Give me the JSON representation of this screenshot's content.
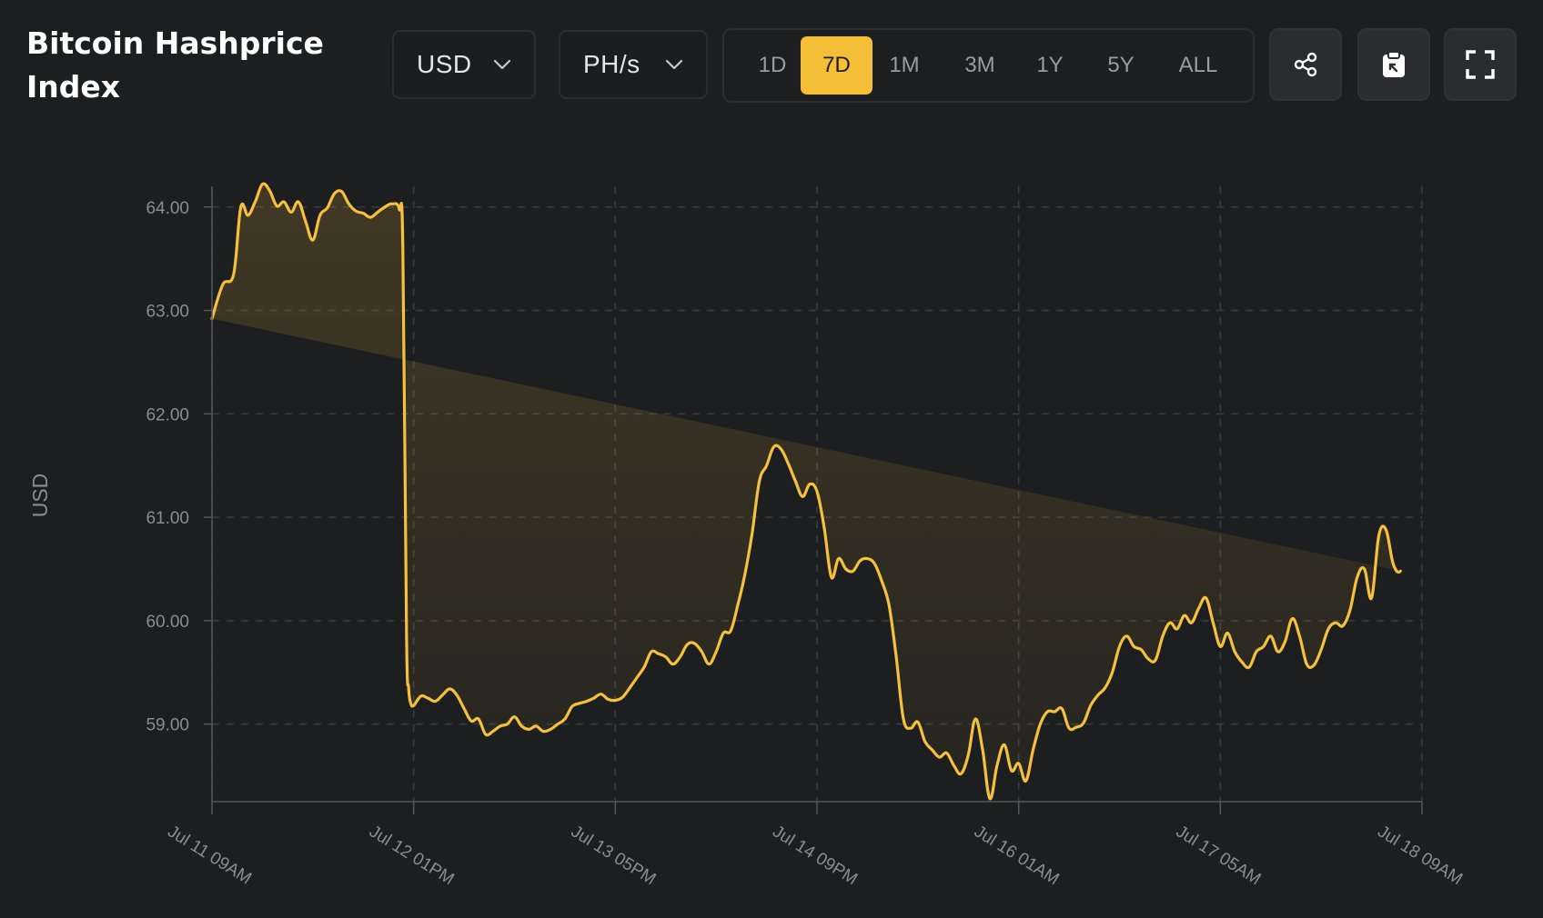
{
  "header": {
    "title": "Bitcoin Hashprice Index",
    "currency_dropdown": {
      "selected": "USD"
    },
    "unit_dropdown": {
      "selected": "PH/s"
    },
    "ranges": [
      {
        "label": "1D",
        "active": false
      },
      {
        "label": "7D",
        "active": true
      },
      {
        "label": "1M",
        "active": false
      },
      {
        "label": "3M",
        "active": false
      },
      {
        "label": "1Y",
        "active": false
      },
      {
        "label": "5Y",
        "active": false
      },
      {
        "label": "ALL",
        "active": false
      }
    ],
    "actions": [
      {
        "icon": "share-icon"
      },
      {
        "icon": "clipboard-icon"
      },
      {
        "icon": "fullscreen-icon"
      }
    ]
  },
  "colors": {
    "background": "#1d1e20",
    "accent": "#f4be37",
    "line": "#f5c13c",
    "grid": "#3a3c40",
    "tick_text": "#8a8c90"
  },
  "chart_data": {
    "type": "area",
    "ylabel": "USD",
    "ylim": [
      58.25,
      64.2
    ],
    "y_ticks": [
      "64.00",
      "63.00",
      "62.00",
      "61.00",
      "60.00",
      "59.00"
    ],
    "y_tick_values": [
      64,
      63,
      62,
      61,
      60,
      59
    ],
    "x_ticks": [
      "Jul 11 09AM",
      "Jul 12 01PM",
      "Jul 13 05PM",
      "Jul 14 09PM",
      "Jul 16 01AM",
      "Jul 17 05AM",
      "Jul 18 09AM"
    ],
    "x_range_hours": [
      0,
      168
    ],
    "x_tick_hours": [
      0,
      28,
      56,
      84,
      112,
      140,
      168
    ],
    "grid": true,
    "legend": "none",
    "series": [
      {
        "x_hours": [
          0,
          1.5,
          3,
          4,
          5,
          6,
          7,
          8,
          9,
          10,
          11,
          12,
          13,
          14,
          15,
          16,
          17,
          18,
          19,
          20,
          21,
          22,
          23,
          24,
          25,
          26,
          26.5,
          27,
          27.3,
          27.6,
          28,
          29,
          30,
          31,
          32,
          33,
          34,
          35,
          36,
          37,
          38,
          39,
          40,
          41,
          42,
          43,
          44,
          45,
          46,
          47,
          48,
          49,
          50,
          51,
          52,
          53,
          54,
          55,
          56,
          57,
          58,
          59,
          60,
          61,
          62,
          63,
          64,
          65,
          66,
          67,
          68,
          69,
          70,
          71,
          72,
          73,
          74,
          75,
          76,
          77,
          78,
          79,
          80,
          81,
          82,
          83,
          84,
          85,
          86,
          87,
          88,
          89,
          90,
          91,
          92,
          93,
          94,
          95,
          96,
          97,
          98,
          99,
          100,
          101,
          102,
          103,
          104,
          105,
          106,
          107,
          108,
          109,
          110,
          111,
          112,
          113,
          114,
          115,
          116,
          117,
          118,
          119,
          120,
          121,
          122,
          123,
          124,
          125,
          126,
          127,
          128,
          129,
          130,
          131,
          132,
          133,
          134,
          135,
          136,
          137,
          138,
          139,
          140,
          141,
          142,
          143,
          144,
          145,
          146,
          147,
          148,
          149,
          150,
          151,
          152,
          153,
          154,
          155,
          156,
          157,
          158,
          159,
          160,
          161,
          162,
          163,
          164,
          165,
          166,
          167,
          168
        ],
        "values": [
          62.92,
          63.25,
          63.35,
          64.0,
          63.92,
          64.05,
          64.22,
          64.16,
          64.01,
          64.05,
          63.95,
          64.05,
          63.86,
          63.68,
          63.92,
          63.99,
          64.13,
          64.15,
          64.03,
          63.96,
          63.94,
          63.9,
          63.95,
          64.0,
          64.03,
          63.98,
          63.6,
          59.9,
          59.35,
          59.2,
          59.18,
          59.27,
          59.25,
          59.22,
          59.28,
          59.34,
          59.28,
          59.15,
          59.03,
          59.05,
          58.9,
          58.93,
          58.98,
          59.0,
          59.07,
          58.98,
          58.95,
          58.98,
          58.93,
          58.95,
          59.0,
          59.05,
          59.17,
          59.2,
          59.22,
          59.25,
          59.29,
          59.24,
          59.23,
          59.26,
          59.35,
          59.45,
          59.55,
          59.7,
          59.68,
          59.65,
          59.58,
          59.65,
          59.77,
          59.78,
          59.7,
          59.58,
          59.7,
          59.88,
          59.9,
          60.15,
          60.45,
          60.85,
          61.35,
          61.5,
          61.68,
          61.66,
          61.52,
          61.35,
          61.2,
          61.32,
          61.25,
          60.9,
          60.42,
          60.6,
          60.5,
          60.48,
          60.58,
          60.6,
          60.55,
          60.38,
          60.15,
          59.65,
          59.05,
          58.96,
          59.02,
          58.83,
          58.75,
          58.68,
          58.72,
          58.6,
          58.52,
          58.7,
          59.05,
          58.75,
          58.28,
          58.6,
          58.8,
          58.55,
          58.62,
          58.45,
          58.75,
          59.0,
          59.12,
          59.12,
          59.15,
          58.96,
          58.97,
          59.01,
          59.18,
          59.28,
          59.35,
          59.5,
          59.75,
          59.85,
          59.75,
          59.72,
          59.63,
          59.62,
          59.85,
          59.98,
          59.92,
          60.05,
          59.98,
          60.12,
          60.22,
          59.98,
          59.75,
          59.88,
          59.7,
          59.6,
          59.55,
          59.7,
          59.75,
          59.85,
          59.7,
          59.8,
          60.02,
          59.85,
          59.58,
          59.57,
          59.72,
          59.92,
          59.98,
          59.95,
          60.1,
          60.42,
          60.5,
          60.22,
          60.82,
          60.88,
          60.55,
          60.48,
          60.7
        ]
      }
    ]
  }
}
